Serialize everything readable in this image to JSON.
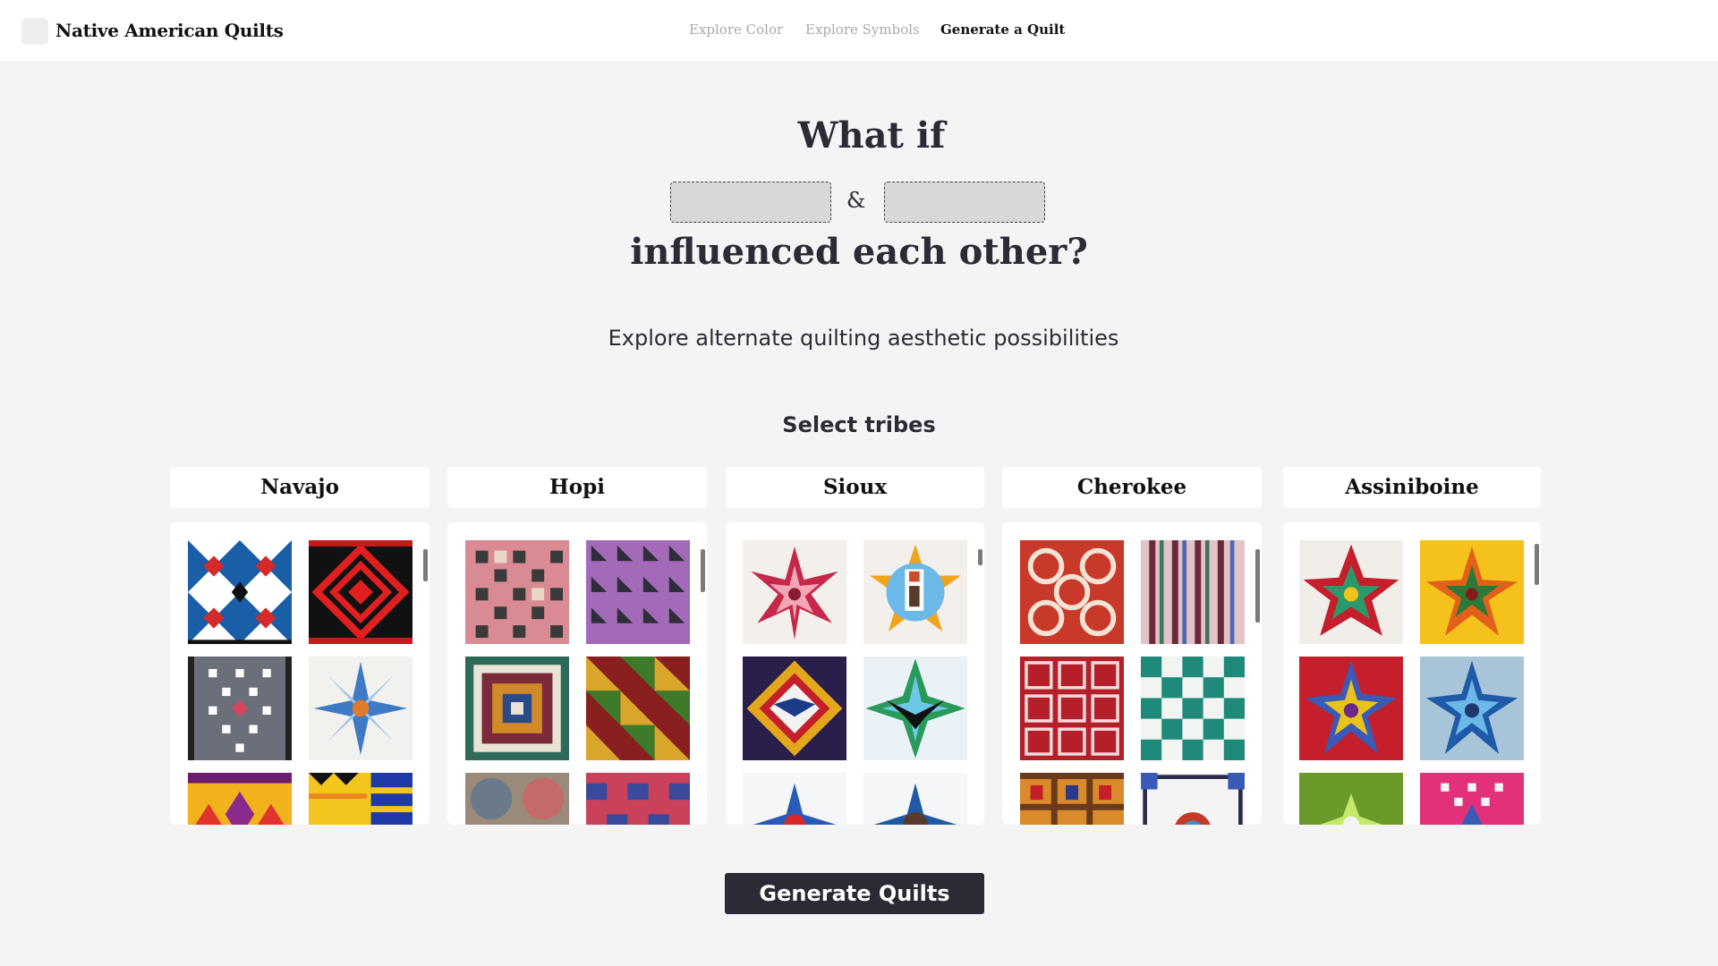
{
  "header": {
    "brand": "Native American Quilts",
    "nav": [
      {
        "label": "Explore Color",
        "active": false
      },
      {
        "label": "Explore Symbols",
        "active": false
      },
      {
        "label": "Generate a Quilt",
        "active": true
      }
    ]
  },
  "hero": {
    "line1": "What if",
    "connector": "&",
    "line2": "influenced each other?",
    "subtitle": "Explore alternate quilting aesthetic possibilities"
  },
  "tribes_section": {
    "title": "Select tribes",
    "tribes": [
      {
        "name": "Navajo"
      },
      {
        "name": "Hopi"
      },
      {
        "name": "Sioux"
      },
      {
        "name": "Cherokee"
      },
      {
        "name": "Assiniboine"
      }
    ]
  },
  "actions": {
    "generate_label": "Generate Quilts"
  },
  "colors": {
    "accent_dark": "#2b2b36",
    "background": "#f4f4f4"
  }
}
